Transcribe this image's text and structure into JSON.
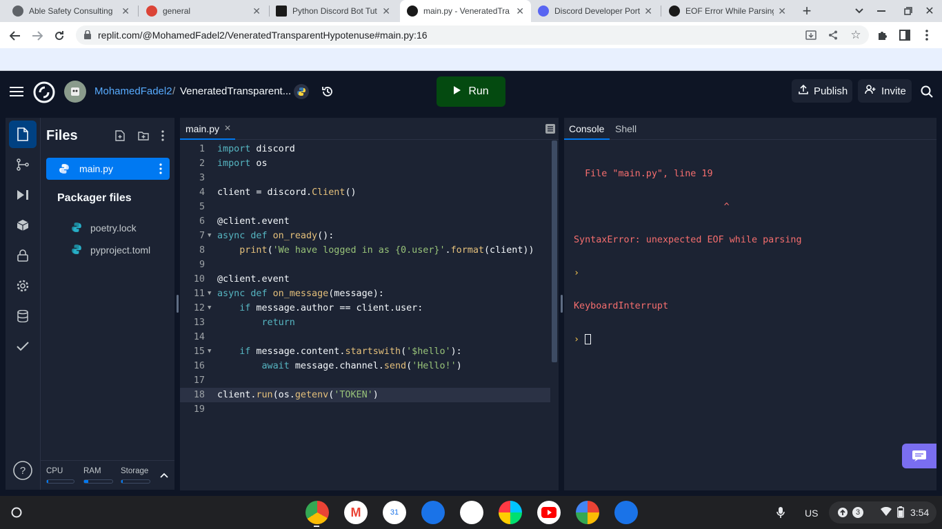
{
  "browser": {
    "tabs": [
      {
        "title": "Able Safety Consulting",
        "favicon_color": "#5f6368"
      },
      {
        "title": "general",
        "favicon_color": "#db4437"
      },
      {
        "title": "Python Discord Bot Tut",
        "favicon_color": "#1a1a1a"
      },
      {
        "title": "main.py - VeneratedTra",
        "favicon_color": "#1a1a1a"
      },
      {
        "title": "Discord Developer Porta",
        "favicon_color": "#5865f2"
      },
      {
        "title": "EOF Error While Parsing",
        "favicon_color": "#1a1a1a"
      }
    ],
    "new_tab_label": "+",
    "url": "replit.com/@MohamedFadel2/VeneratedTransparentHypotenuse#main.py:16"
  },
  "replit": {
    "username": "MohamedFadel2",
    "separator": "/",
    "repl_name": "VeneratedTransparent...",
    "run_label": "Run",
    "publish_label": "Publish",
    "invite_label": "Invite"
  },
  "files": {
    "heading": "Files",
    "main_file": "main.py",
    "packager_heading": "Packager files",
    "packager_files": [
      "poetry.lock",
      "pyproject.toml"
    ],
    "resources": [
      "CPU",
      "RAM",
      "Storage"
    ]
  },
  "editor": {
    "tab_label": "main.py",
    "lines": [
      {
        "n": "1",
        "t": "import discord"
      },
      {
        "n": "2",
        "t": "import os"
      },
      {
        "n": "3",
        "t": ""
      },
      {
        "n": "4",
        "t": "client = discord.Client()"
      },
      {
        "n": "5",
        "t": ""
      },
      {
        "n": "6",
        "t": "@client.event"
      },
      {
        "n": "7",
        "t": "async def on_ready():"
      },
      {
        "n": "8",
        "t": "    print('We have logged in as {0.user}'.format(client))"
      },
      {
        "n": "9",
        "t": ""
      },
      {
        "n": "10",
        "t": "@client.event"
      },
      {
        "n": "11",
        "t": "async def on_message(message):"
      },
      {
        "n": "12",
        "t": "    if message.author == client.user:"
      },
      {
        "n": "13",
        "t": "        return"
      },
      {
        "n": "14",
        "t": ""
      },
      {
        "n": "15",
        "t": "    if message.content.startswith('$hello'):"
      },
      {
        "n": "16",
        "t": "        await message.channel.send('Hello!')"
      },
      {
        "n": "17",
        "t": ""
      },
      {
        "n": "18",
        "t": "client.run(os.getenv('TOKEN')"
      },
      {
        "n": "19",
        "t": ""
      }
    ]
  },
  "console": {
    "tabs": [
      "Console",
      "Shell"
    ],
    "lines": [
      "  File \"main.py\", line 19",
      "                           ^",
      "SyntaxError: unexpected EOF while parsing",
      "KeyboardInterrupt"
    ]
  },
  "shelf": {
    "ime": "US",
    "notif_count": "3",
    "time": "3:54"
  },
  "colors": {
    "accent": "#0079f2",
    "run_green": "#044a10",
    "error_red": "#f66e6e",
    "prompt_yellow": "#f9c74f"
  }
}
